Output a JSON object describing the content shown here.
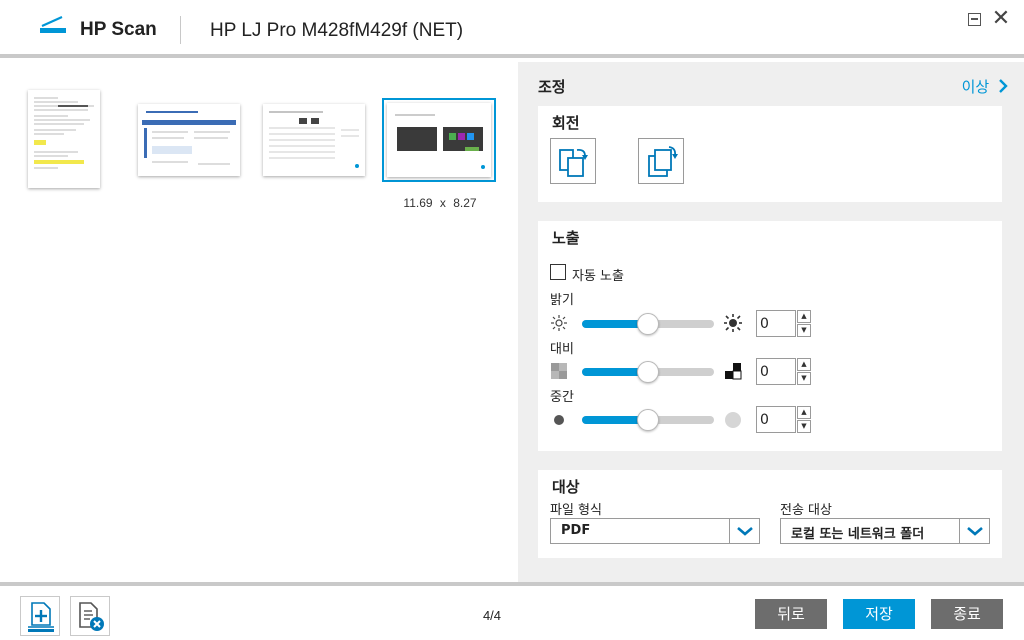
{
  "header": {
    "app_title": "HP Scan",
    "device_name": "HP LJ Pro M428fM429f (NET)",
    "minimize_label": "minimize",
    "close_glyph": "✕"
  },
  "preview": {
    "thumbnails": [
      {
        "name": "page-1",
        "selected": false
      },
      {
        "name": "page-2",
        "selected": false
      },
      {
        "name": "page-3",
        "selected": false
      },
      {
        "name": "page-4",
        "selected": true
      }
    ],
    "selected_size": "11.69 x 8.27"
  },
  "panel": {
    "title": "조정",
    "advanced_link": "이상",
    "rotation": {
      "title": "회전",
      "rotate_left_icon": "rotate-left-icon",
      "rotate_right_icon": "rotate-right-icon"
    },
    "exposure": {
      "title": "노출",
      "auto_label": "자동 노출",
      "auto_checked": false,
      "brightness": {
        "label": "밝기",
        "value": "0",
        "level": 0.5
      },
      "contrast": {
        "label": "대비",
        "value": "0",
        "level": 0.5
      },
      "midtone": {
        "label": "중간",
        "value": "0",
        "level": 0.5
      }
    },
    "destination": {
      "title": "대상",
      "file_type_label": "파일 형식",
      "file_type_value": "PDF",
      "send_to_label": "전송 대상",
      "send_to_value": "로컬 또는 네트워크 폴더"
    }
  },
  "footer": {
    "page_counter": "4/4",
    "back_label": "뒤로",
    "save_label": "저장",
    "exit_label": "종료"
  },
  "colors": {
    "accent": "#0096d6",
    "button_gray": "#6d6d6d",
    "panel_bg": "#efefef"
  }
}
